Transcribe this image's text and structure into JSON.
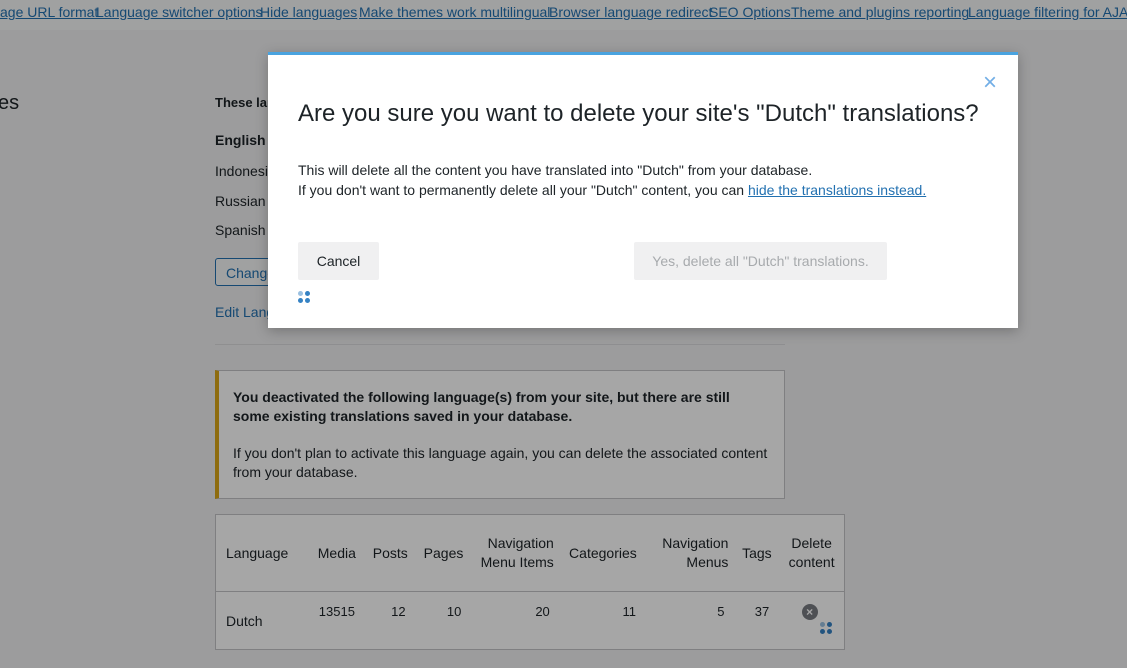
{
  "top_links": [
    "age URL format",
    "Language switcher options",
    "Hide languages",
    "Make themes work multilingual",
    "Browser language redirect",
    "SEO Options",
    "Theme and plugins reporting",
    "Language filtering for AJAX"
  ],
  "page": {
    "title_fragment": "es",
    "intro_fragment": "These lan",
    "languages": [
      "English (",
      "Indonesia",
      "Russian",
      "Spanish"
    ],
    "change_button_fragment": "Change",
    "edit_link_fragment": "Edit Lang"
  },
  "notice": {
    "heading": "You deactivated the following language(s) from your site, but there are still some existing translations saved in your database.",
    "text": "If you don't plan to activate this language again, you can delete the associated content from your database."
  },
  "table": {
    "headers": [
      "Language",
      "Media",
      "Posts",
      "Pages",
      "Navigation Menu Items",
      "Categories",
      "Navigation Menus",
      "Tags",
      "Delete content"
    ],
    "rows": [
      {
        "language": "Dutch",
        "media": "13515",
        "posts": "12",
        "pages": "10",
        "nav_menu_items": "20",
        "categories": "11",
        "nav_menus": "5",
        "tags": "37"
      }
    ]
  },
  "modal": {
    "title": "Are you sure you want to delete your site's \"Dutch\" translations?",
    "line1": "This will delete all the content you have translated into \"Dutch\" from your database.",
    "line2_prefix": "If you don't want to permanently delete all your \"Dutch\" content, you can ",
    "line2_link": "hide the translations instead.",
    "cancel_label": "Cancel",
    "confirm_label": "Yes, delete all \"Dutch\" translations.",
    "close_icon": "close-icon"
  }
}
